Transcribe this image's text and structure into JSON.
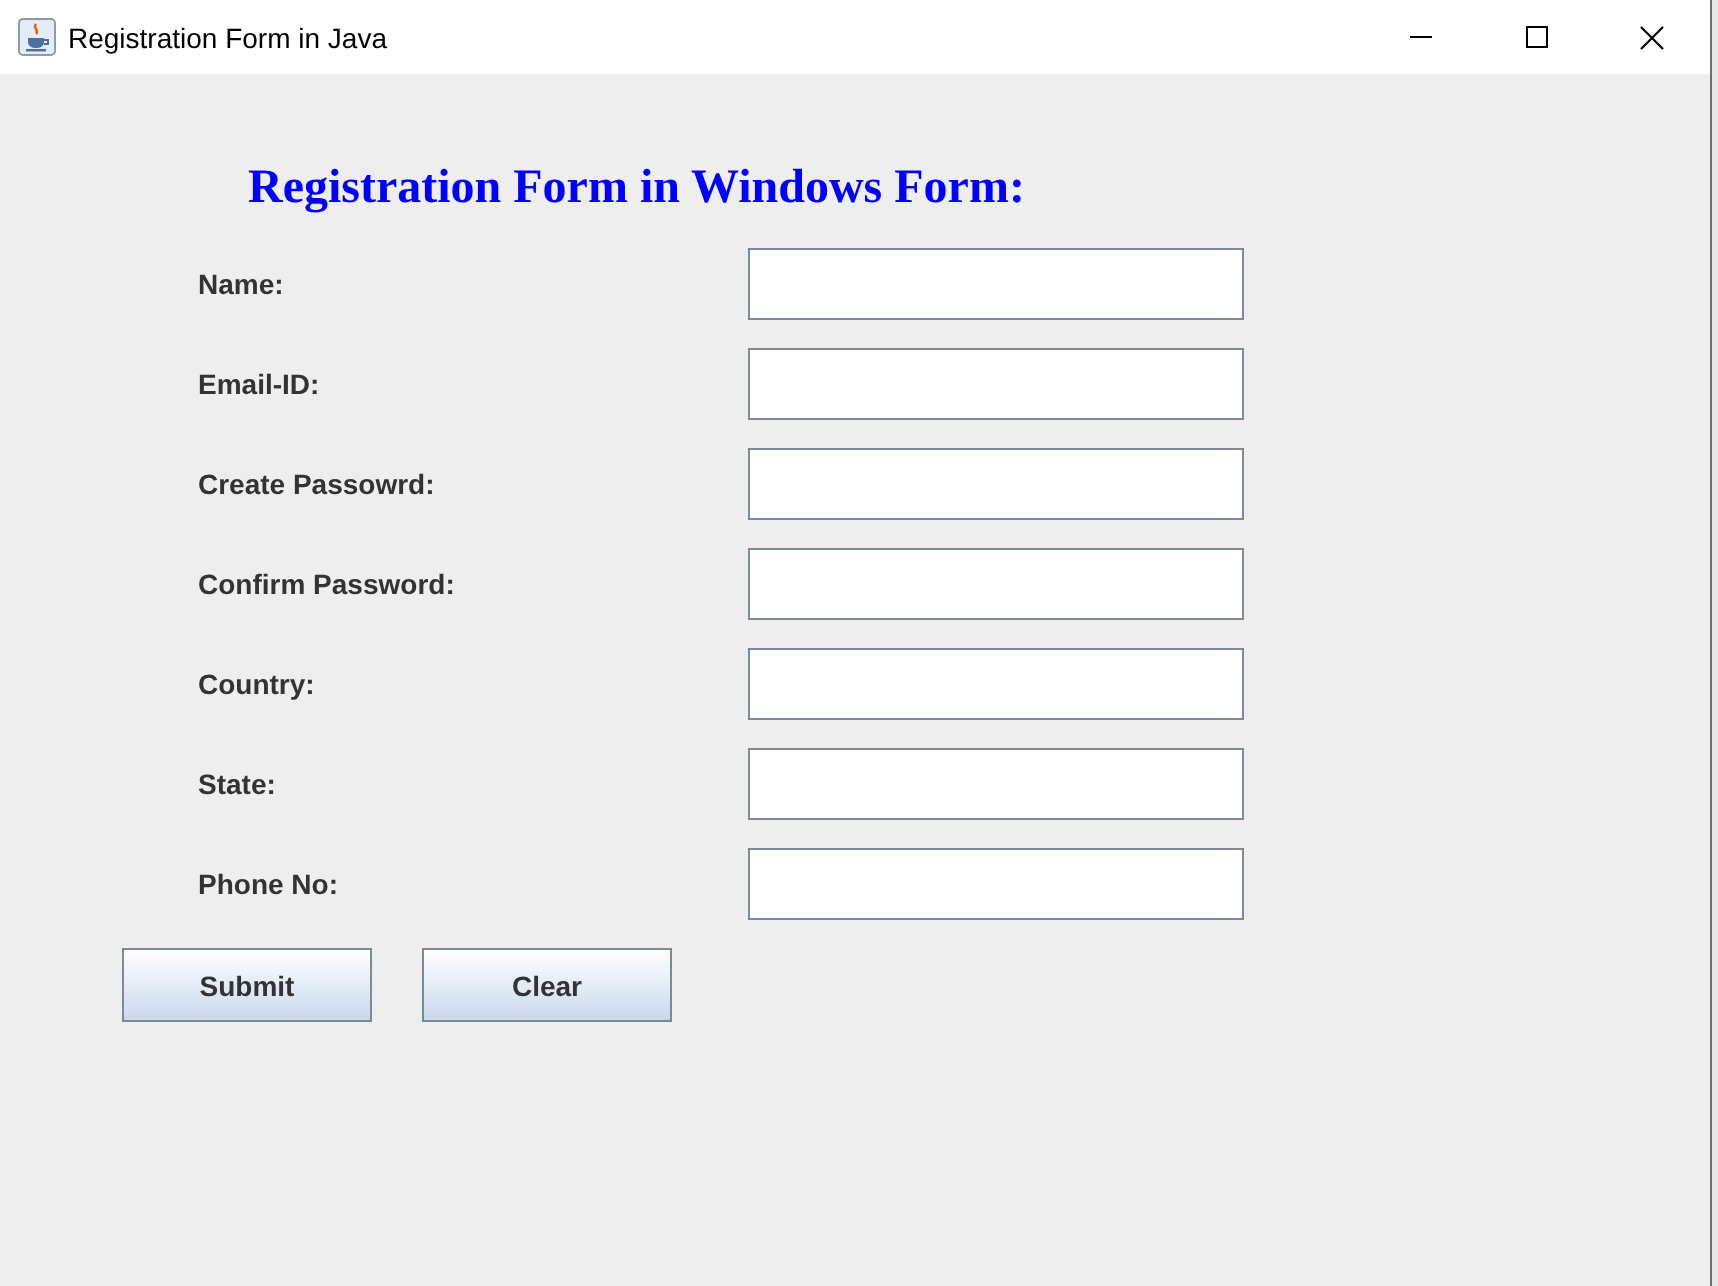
{
  "window": {
    "title": "Registration Form in Java"
  },
  "heading": "Registration Form in Windows Form:",
  "fields": [
    {
      "label": "Name:"
    },
    {
      "label": "Email-ID:"
    },
    {
      "label": "Create Passowrd:"
    },
    {
      "label": "Confirm Password:"
    },
    {
      "label": "Country:"
    },
    {
      "label": "State:"
    },
    {
      "label": "Phone No:"
    }
  ],
  "buttons": [
    "Submit",
    "Clear"
  ]
}
